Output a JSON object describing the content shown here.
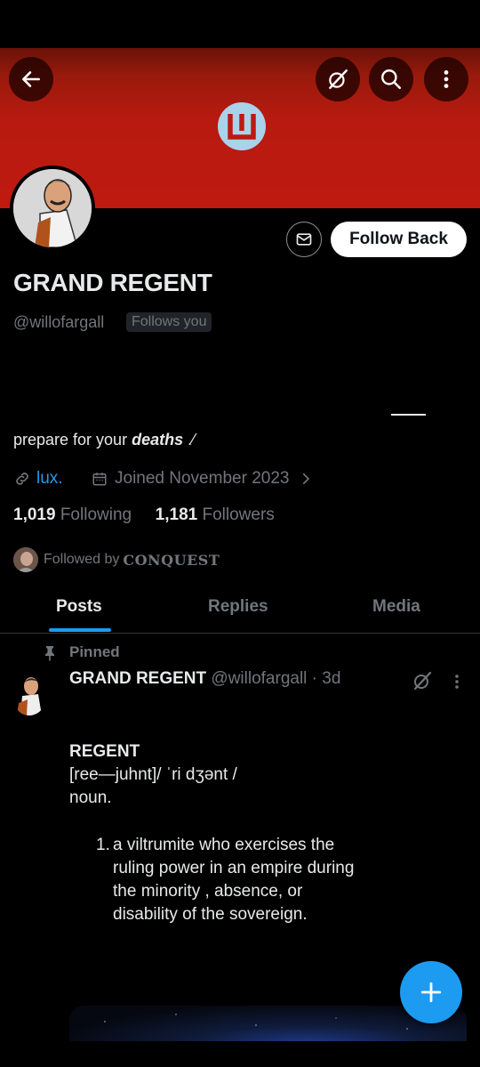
{
  "colors": {
    "accent": "#1d9bf0",
    "banner": "#be1a10",
    "muted": "#71767b",
    "text": "#e7e9ea"
  },
  "header": {
    "icons": [
      "back-arrow-icon",
      "grok-icon",
      "search-icon",
      "more-vertical-icon"
    ]
  },
  "profile": {
    "name": "GRAND REGENT",
    "handle": "@willofargall",
    "follows_you": "Follows you",
    "follow_button": "Follow Back",
    "bio_prefix": "prepare for your ",
    "bio_emph": "deaths",
    "bio_suffix": " .⁄",
    "link": "lux.",
    "joined": "Joined November 2023",
    "following_count": "1,019",
    "following_label": "Following",
    "followers_count": "1,181",
    "followers_label": "Followers",
    "followed_by_label": "Followed by",
    "followed_by_name": "CONQUEST"
  },
  "tabs": [
    {
      "label": "Posts",
      "active": true
    },
    {
      "label": "Replies",
      "active": false
    },
    {
      "label": "Media",
      "active": false
    }
  ],
  "post": {
    "pinned_label": "Pinned",
    "author": "GRAND REGENT",
    "handle_time": "@willofargall · 3d",
    "title": "REGENT",
    "pron_1": "[ree—juhnt]/ ˈri dʒənt /",
    "pron_2": "noun.",
    "def_num": "1.",
    "def_text": "a viltrumite who exercises the ruling power in an empire during the minority , absence, or disability of the sovereign."
  },
  "fab": {
    "icon": "plus-icon"
  }
}
